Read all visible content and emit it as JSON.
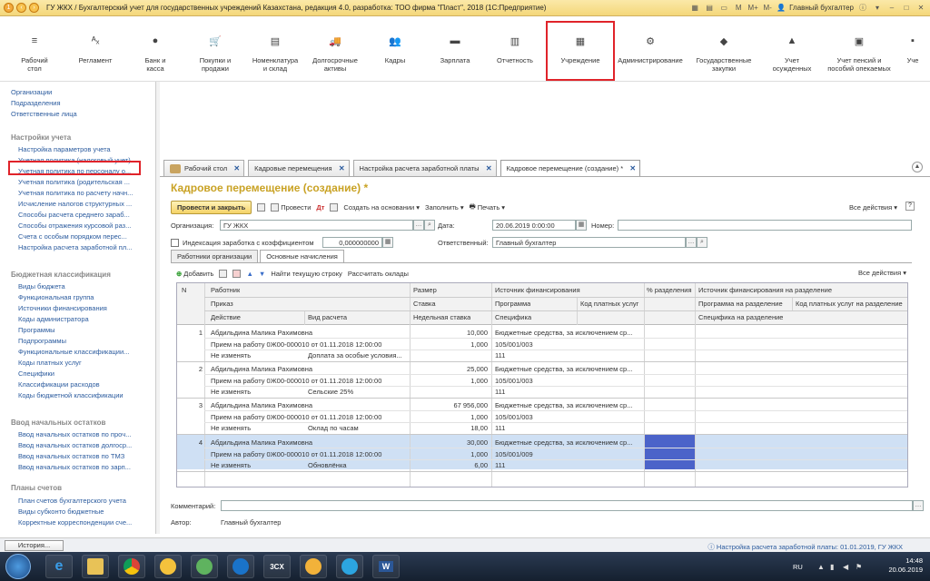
{
  "window": {
    "title": "ГУ ЖКХ / Бухгалтерский учет для государственных учреждений Казахстана, редакция 4.0, разработка: ТОО фирма \"Пласт\", 2018  (1С:Предприятие)",
    "user": "Главный бухгалтер",
    "m1": "M",
    "m2": "M+",
    "m3": "M-"
  },
  "sections": [
    {
      "icon": "menu-icon",
      "glyph": "≡",
      "label": "Рабочий\nстол"
    },
    {
      "icon": "regulations-icon",
      "glyph": "ᴬₓ",
      "label": "Регламент"
    },
    {
      "icon": "bank-icon",
      "glyph": "●",
      "label": "Банк и\nкасса"
    },
    {
      "icon": "cart-icon",
      "glyph": "🛒",
      "label": "Покупки и\nпродажи"
    },
    {
      "icon": "warehouse-icon",
      "glyph": "▤",
      "label": "Номенклатура\nи склад"
    },
    {
      "icon": "truck-icon",
      "glyph": "🚚",
      "label": "Долгосрочные\nактивы"
    },
    {
      "icon": "people-icon",
      "glyph": "👥",
      "label": "Кадры"
    },
    {
      "icon": "salary-icon",
      "glyph": "▬",
      "label": "Зарплата"
    },
    {
      "icon": "reports-icon",
      "glyph": "▥",
      "label": "Отчетность"
    },
    {
      "icon": "institution-icon",
      "glyph": "▦",
      "label": "Учреждение"
    },
    {
      "icon": "gear-icon",
      "glyph": "⚙",
      "label": "Администрирование"
    },
    {
      "icon": "procurement-icon",
      "glyph": "◆",
      "label": "Государственные\nзакупки"
    },
    {
      "icon": "convicts-icon",
      "glyph": "▲",
      "label": "Учет\nосужденных"
    },
    {
      "icon": "pension-icon",
      "glyph": "▣",
      "label": "Учет пенсий и\nпособий опекаемых"
    },
    {
      "icon": "more-icon",
      "glyph": "▪",
      "label": "Уче"
    }
  ],
  "leftnav": {
    "top": [
      "Организации",
      "Подразделения",
      "Ответственные лица"
    ],
    "group1": {
      "title": "Настройки учета",
      "items": [
        "Настройка параметров учета",
        "Учетная политика (налоговый учет)",
        "Учетная политика по персоналу о...",
        "Учетная политика (родительская ...",
        "Учетная политика по расчету начн...",
        "Исчисление налогов структурных ...",
        "Способы расчета среднего зараб...",
        "Способы отражения курсовой раз...",
        "Счета с особым порядком перес...",
        "Настройка расчета заработной пл..."
      ]
    },
    "group2": {
      "title": "Бюджетная классификация",
      "items": [
        "Виды бюджета",
        "Функциональная группа",
        "Источники финансирования",
        "Коды администратора",
        "Программы",
        "Подпрограммы",
        "Функциональные классификации...",
        "Коды платных услуг",
        "Специфики",
        "Классификации расходов",
        "Коды бюджетной классификации"
      ]
    },
    "group3": {
      "title": "Ввод начальных остатков",
      "items": [
        "Ввод начальных остатков по прoч...",
        "Ввод начальных остатков долгоср...",
        "Ввод начальных остатков по ТМЗ",
        "Ввод начальных остатков по зарп..."
      ]
    },
    "group4": {
      "title": "Планы счетов",
      "items": [
        "План счетов бухгалтерского учета",
        "Виды субконто бюджетные",
        "Корректные корреспонденции сче..."
      ]
    }
  },
  "tabs": [
    {
      "label": "Рабочий стол"
    },
    {
      "label": "Кадровые перемещения"
    },
    {
      "label": "Настройка расчета заработной платы"
    },
    {
      "label": "Кадровое перемещение (создание) *"
    }
  ],
  "doc": {
    "title": "Кадровое перемещение (создание) *",
    "toolbar": {
      "post_close": "Провести и закрыть",
      "post": "Провести",
      "create_basis": "Создать на основании",
      "fill": "Заполнить",
      "print": "Печать",
      "all_actions": "Все действия"
    },
    "org_label": "Организация:",
    "org_value": "ГУ ЖКХ",
    "date_label": "Дата:",
    "date_value": "20.06.2019  0:00:00",
    "number_label": "Номер:",
    "number_value": "",
    "index_label": "Индексация заработка с коэффициентом",
    "index_value": "0,000000000",
    "resp_label": "Ответственный:",
    "resp_value": "Главный бухгалтер",
    "subtabs": [
      "Работники организации",
      "Основные начисления"
    ],
    "subtoolbar": {
      "add": "Добавить",
      "find_current": "Найти текущую строку",
      "calc_salaries": "Рассчитать оклады",
      "all_actions": "Все действия"
    },
    "columns": {
      "n": "N",
      "worker": "Работник",
      "order": "Приказ",
      "action": "Действие",
      "calc_kind": "Вид расчета",
      "size": "Размер",
      "rate": "Ставка",
      "norm": "Недельная ставка",
      "source": "Источник финансирования",
      "program": "Программа",
      "paid_code": "Код платных услуг",
      "spec": "Специфика",
      "pct_split": "% разделения",
      "source_split": "Источник финансирования на разделение",
      "program_split": "Программа на разделение",
      "paid_split": "Код платных услуг на разделение",
      "spec_split": "Специфика на разделение"
    },
    "rows": [
      {
        "n": "1",
        "worker": "Абдильдина Малика Рахимовна",
        "order": "Прием на работу 0Ж00-000010 от 01.11.2018 12:00:00",
        "action": "Не изменять",
        "calc": "Доплата за особые условия...",
        "size": "10,000",
        "rate": "1,000",
        "norm": "",
        "source": "Бюджетные средства, за исключением ср...",
        "program": "105/001/003",
        "spec": "111"
      },
      {
        "n": "2",
        "worker": "Абдильдина Малика Рахимовна",
        "order": "Прием на работу 0Ж00-000010 от 01.11.2018 12:00:00",
        "action": "Не изменять",
        "calc": "Сельские 25%",
        "size": "25,000",
        "rate": "1,000",
        "norm": "",
        "source": "Бюджетные средства, за исключением ср...",
        "program": "105/001/003",
        "spec": "111"
      },
      {
        "n": "3",
        "worker": "Абдильдина Малика Рахимовна",
        "order": "Прием на работу 0Ж00-000010 от 01.11.2018 12:00:00",
        "action": "Не изменять",
        "calc": "Оклад по часам",
        "size": "67 956,000",
        "rate": "1,000",
        "norm": "18,00",
        "source": "Бюджетные средства, за исключением ср...",
        "program": "105/001/003",
        "spec": "111"
      },
      {
        "n": "4",
        "worker": "Абдильдина Малика Рахимовна",
        "order": "Прием на работу 0Ж00-000010 от 01.11.2018 12:00:00",
        "action": "Не изменять",
        "calc": "Обновлёнка",
        "size": "30,000",
        "rate": "1,000",
        "norm": "6,00",
        "source": "Бюджетные средства, за исключением ср...",
        "program": "105/001/009",
        "spec": "111"
      }
    ],
    "comment_label": "Комментарий:",
    "author_label": "Автор:",
    "author_value": "Главный бухгалтер"
  },
  "status": {
    "history": "История...",
    "right": "Настройка расчета заработной платы: 01.01.2019, ГУ ЖКХ"
  },
  "taskbar": {
    "lang": "RU",
    "time": "14:48",
    "date": "20.06.2019",
    "apps": [
      "ie-icon",
      "explorer-icon",
      "chrome-icon",
      "onec-icon",
      "gallery-icon",
      "teamviewer-icon",
      "3cx-icon",
      "onec2-icon",
      "telegram-icon",
      "word-icon"
    ],
    "labels": {
      "3cx": "3CX",
      "word": "W"
    }
  }
}
